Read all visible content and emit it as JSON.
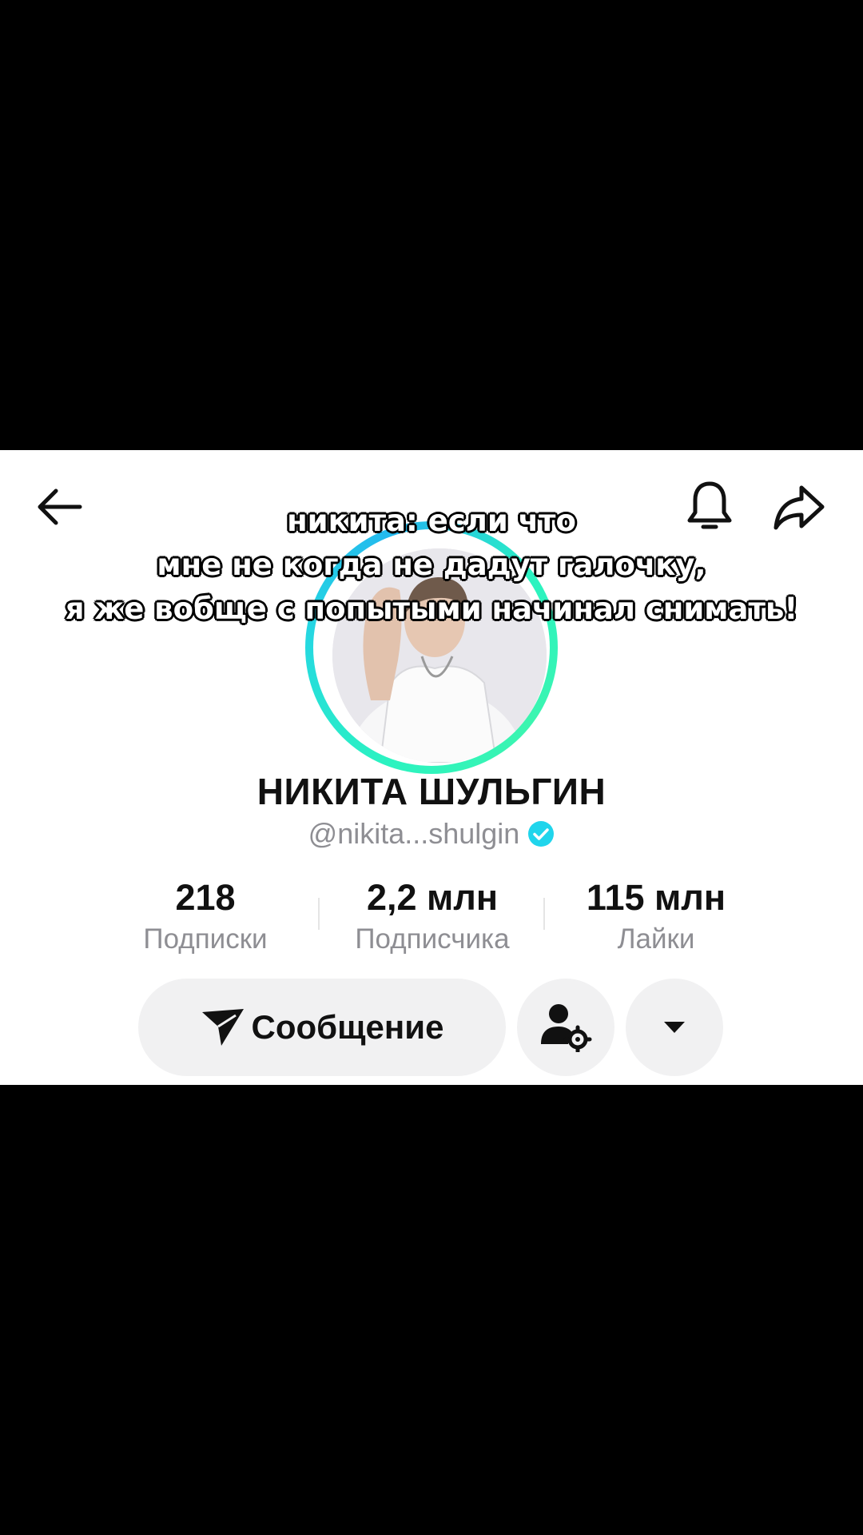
{
  "caption": {
    "line1": "никита: если что",
    "line2": "мне не когда не дадут галочку,",
    "line3": "я же вобще с попытыми начинал снимать!"
  },
  "header": {
    "back_icon": "arrow-left-icon",
    "bell_icon": "bell-icon",
    "share_icon": "share-arrow-icon"
  },
  "profile": {
    "name": "НИКИТА ШУЛЬГИН",
    "handle": "@nikita...shulgin",
    "verified_color": "#20d5ec"
  },
  "stats": [
    {
      "value": "218",
      "label": "Подписки"
    },
    {
      "value": "2,2 млн",
      "label": "Подписчика"
    },
    {
      "value": "115 млн",
      "label": "Лайки"
    }
  ],
  "actions": {
    "message_label": "Сообщение",
    "message_icon": "paper-plane-icon",
    "friends_icon": "user-settings-icon",
    "more_icon": "caret-down-icon"
  }
}
